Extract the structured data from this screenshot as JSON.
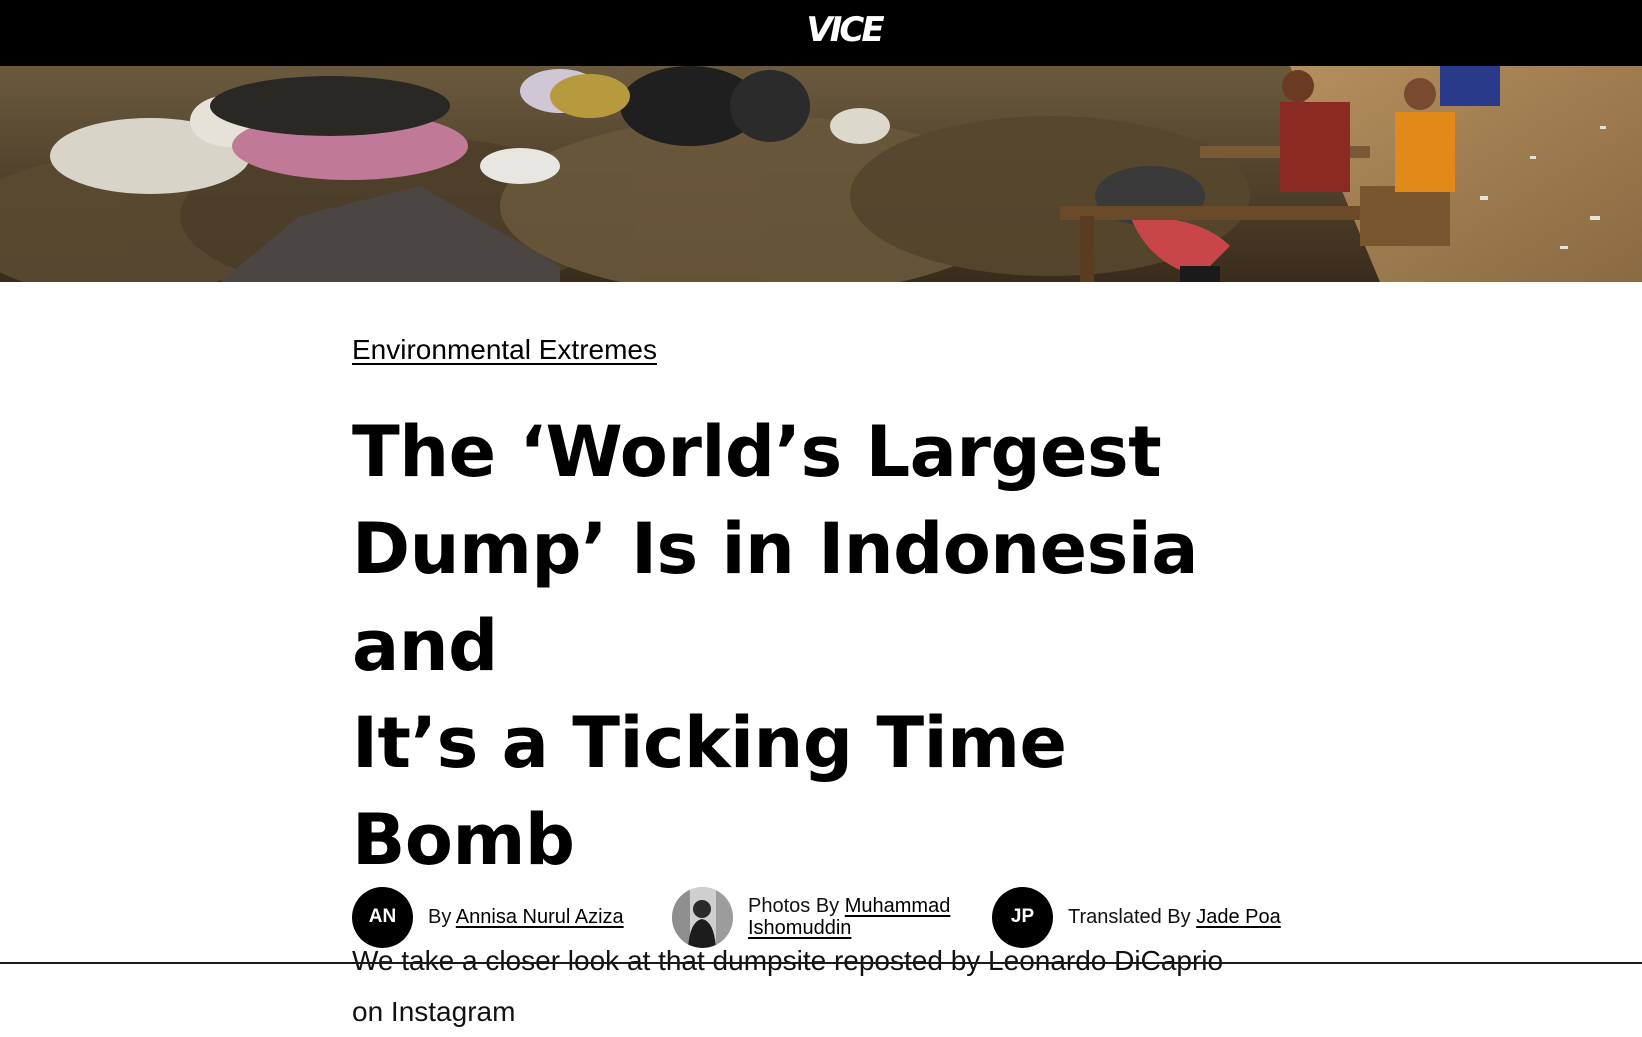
{
  "site": {
    "logo_text": "VICE",
    "logo_name": "vice-logo"
  },
  "hero": {
    "icon": "hero-photo-dumpsite"
  },
  "article": {
    "category": "Environmental Extremes",
    "headline_lines": [
      "The ‘World’s Largest",
      "Dump’ Is in Indonesia and",
      "It’s a Ticking Time Bomb"
    ],
    "dek_lines": [
      "We take a closer look at that dumpsite reposted by Leonardo DiCaprio",
      "on Instagram"
    ]
  },
  "bylines": [
    {
      "initials": "AN",
      "prefix": "By",
      "name": "Annisa Nurul Aziza"
    },
    {
      "avatar_icon": "photographer-photo",
      "prefix": "Photos By",
      "name_line1": "Muhammad",
      "name_line2": "Ishomuddin"
    },
    {
      "initials": "JP",
      "prefix": "Translated By",
      "name": "Jade Poa"
    }
  ],
  "colors": {
    "nav_bg": "#000000",
    "text": "#000000",
    "background": "#ffffff"
  }
}
